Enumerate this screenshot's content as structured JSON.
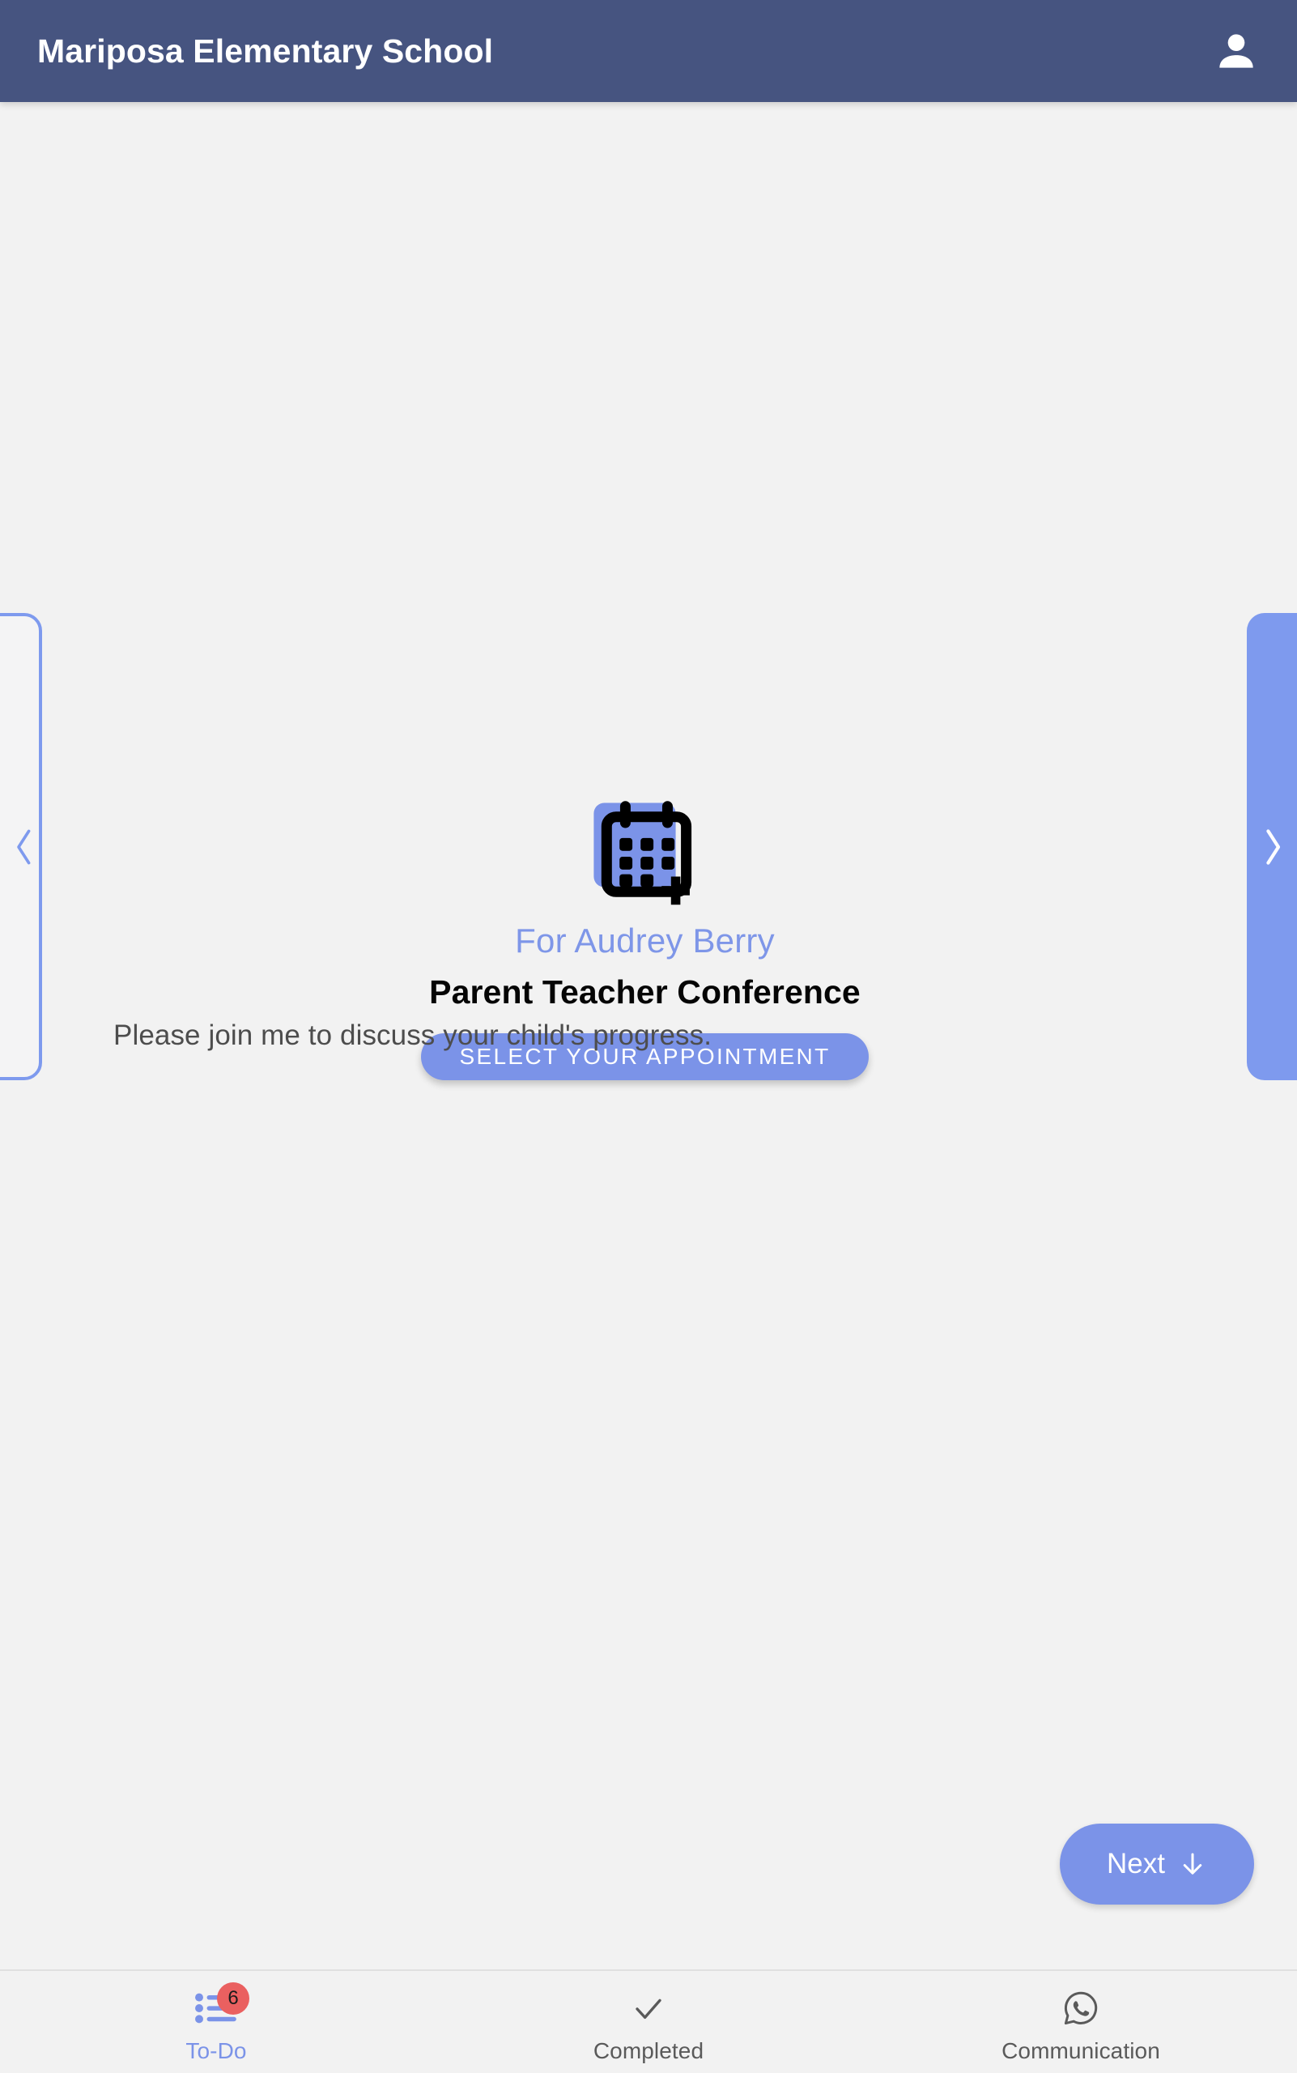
{
  "appbar": {
    "title": "Mariposa Elementary School",
    "account_icon": "account-circle-icon"
  },
  "carousel": {
    "prev_icon": "chevron-left-icon",
    "next_icon": "chevron-right-icon",
    "card": {
      "icon": "calendar-add-icon",
      "for_line": "For Audrey Berry",
      "title": "Parent Teacher Conference",
      "action_label": "SELECT YOUR APPOINTMENT"
    }
  },
  "description": "Please join me to discuss your child's progress.",
  "next_button": {
    "label": "Next",
    "icon": "arrow-down-icon"
  },
  "bottom_nav": {
    "items": [
      {
        "label": "To-Do",
        "icon": "list-icon",
        "badge": "6",
        "active": true
      },
      {
        "label": "Completed",
        "icon": "check-icon",
        "badge": "",
        "active": false
      },
      {
        "label": "Communication",
        "icon": "whatsapp-icon",
        "badge": "",
        "active": false
      }
    ]
  },
  "colors": {
    "appbar_bg": "#465480",
    "accent": "#7b93e8",
    "page_bg": "#f2f2f2",
    "badge_bg": "#ea6060",
    "body_text": "#4d4d4d"
  }
}
